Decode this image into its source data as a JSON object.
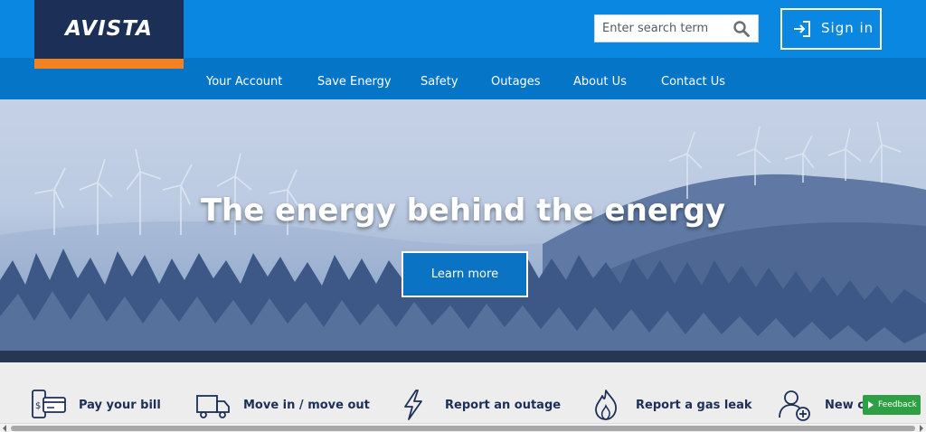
{
  "header": {
    "logo_text": "AVISTA",
    "search": {
      "placeholder": "Enter search term",
      "icon": "search-icon"
    },
    "sign_in": {
      "label": "Sign in",
      "icon": "sign-in-icon"
    },
    "colors": {
      "brand_navy": "#1b2f57",
      "brand_orange": "#f58220",
      "header_blue": "#0a87e0",
      "nav_blue": "#0575c8"
    }
  },
  "nav": {
    "items": [
      {
        "label": "Your Account"
      },
      {
        "label": "Save Energy"
      },
      {
        "label": "Safety"
      },
      {
        "label": "Outages"
      },
      {
        "label": "About Us"
      },
      {
        "label": "Contact Us"
      }
    ]
  },
  "hero": {
    "title": "The energy behind the energy",
    "cta_label": "Learn more"
  },
  "quick_links": {
    "items": [
      {
        "label": "Pay your bill",
        "icon": "bill-payment-icon"
      },
      {
        "label": "Move in / move out",
        "icon": "moving-truck-icon"
      },
      {
        "label": "Report an outage",
        "icon": "lightning-bolt-icon"
      },
      {
        "label": "Report a gas leak",
        "icon": "flame-icon"
      },
      {
        "label": "New cu",
        "icon": "add-user-icon"
      }
    ]
  },
  "feedback": {
    "label": "Feedback"
  }
}
